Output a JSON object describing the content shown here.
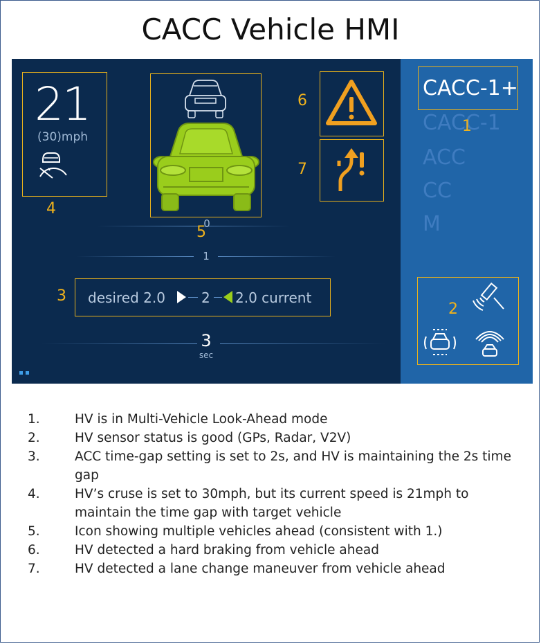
{
  "title": "CACC Vehicle HMI",
  "speed": {
    "current": "21",
    "set": "(30)mph"
  },
  "modes": [
    {
      "label": "CACC-1+",
      "active": true
    },
    {
      "label": "CACC-1",
      "active": false
    },
    {
      "label": "ACC",
      "active": false
    },
    {
      "label": "CC",
      "active": false
    },
    {
      "label": "M",
      "active": false
    }
  ],
  "gap": {
    "desired": "desired 2.0",
    "setting": "2",
    "current": "2.0 current",
    "unit": "sec"
  },
  "gap_ticks": [
    "0",
    "1",
    "3"
  ],
  "callouts": {
    "c1": "1",
    "c2": "2",
    "c3": "3",
    "c4": "4",
    "c5": "5",
    "c6": "6",
    "c7": "7"
  },
  "notes": [
    {
      "num": "1.",
      "text": "HV is in Multi-Vehicle Look-Ahead mode"
    },
    {
      "num": "2.",
      "text": "HV sensor status is good (GPs, Radar, V2V)"
    },
    {
      "num": "3.",
      "text": "ACC time-gap setting is set to 2s, and HV is maintaining the 2s time gap"
    },
    {
      "num": "4.",
      "text": "HV’s cruse is set to 30mph, but its current speed is 21mph to maintain the time gap with target vehicle"
    },
    {
      "num": "5.",
      "text": "Icon showing multiple vehicles ahead (consistent with 1.)"
    },
    {
      "num": "6.",
      "text": "HV detected a hard braking from vehicle ahead"
    },
    {
      "num": "7.",
      "text": "HV detected a lane change maneuver from vehicle ahead"
    }
  ],
  "colors": {
    "panel": "#0b2a4e",
    "side_panel": "#2065a8",
    "highlight": "#e8b11c",
    "car_green": "#9acd1c",
    "warning_orange": "#f0a020"
  }
}
